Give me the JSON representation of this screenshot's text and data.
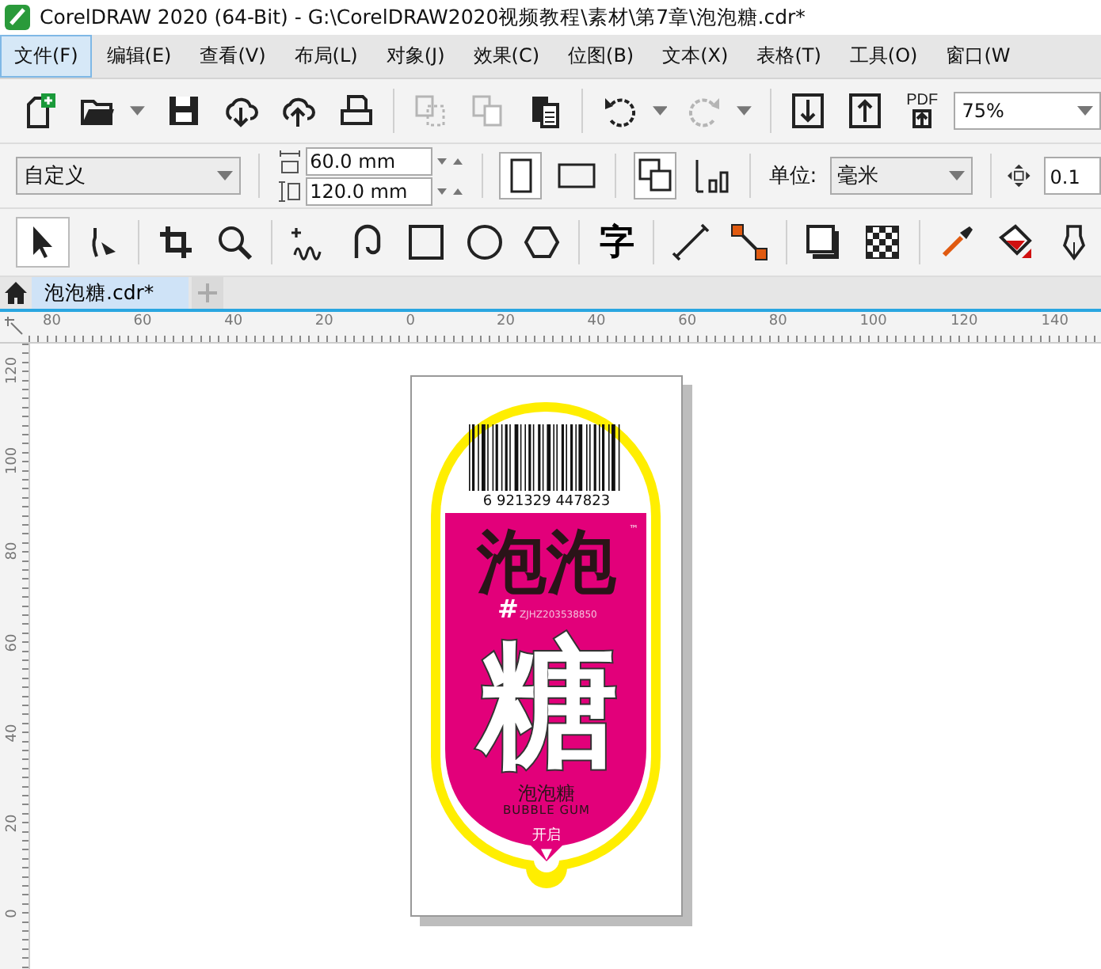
{
  "window": {
    "title": "CorelDRAW 2020 (64-Bit) - G:\\CorelDRAW2020视频教程\\素材\\第7章\\泡泡糖.cdr*"
  },
  "menu": [
    {
      "label": "文件(F)",
      "selected": true
    },
    {
      "label": "编辑(E)",
      "selected": false
    },
    {
      "label": "查看(V)",
      "selected": false
    },
    {
      "label": "布局(L)",
      "selected": false
    },
    {
      "label": "对象(J)",
      "selected": false
    },
    {
      "label": "效果(C)",
      "selected": false
    },
    {
      "label": "位图(B)",
      "selected": false
    },
    {
      "label": "文本(X)",
      "selected": false
    },
    {
      "label": "表格(T)",
      "selected": false
    },
    {
      "label": "工具(O)",
      "selected": false
    },
    {
      "label": "窗口(W",
      "selected": false
    }
  ],
  "toolbar": {
    "buttons": [
      {
        "kind": "new",
        "disabled": false
      },
      {
        "kind": "open",
        "disabled": false
      },
      {
        "kind": "save",
        "disabled": false
      },
      {
        "kind": "cloud-down",
        "disabled": false
      },
      {
        "kind": "cloud-up",
        "disabled": false
      },
      {
        "kind": "print",
        "disabled": false
      },
      {
        "kind": "cut",
        "disabled": true
      },
      {
        "kind": "copy",
        "disabled": true
      },
      {
        "kind": "paste",
        "disabled": false
      },
      {
        "kind": "undo",
        "disabled": false
      },
      {
        "kind": "redo",
        "disabled": true
      },
      {
        "kind": "import",
        "disabled": false
      },
      {
        "kind": "export",
        "disabled": false
      },
      {
        "kind": "pdf",
        "label": "PDF",
        "disabled": false
      }
    ],
    "zoom": "75%"
  },
  "property_bar": {
    "preset": "自定义",
    "width": "60.0 mm",
    "height": "120.0 mm",
    "units_label": "单位:",
    "units": "毫米",
    "nudge": "0.1"
  },
  "toolbox": [
    {
      "kind": "pick",
      "selected": true
    },
    {
      "kind": "shape",
      "selected": false
    },
    {
      "kind": "crop",
      "selected": false
    },
    {
      "kind": "zoom",
      "selected": false
    },
    {
      "kind": "freehand",
      "selected": false
    },
    {
      "kind": "artistic",
      "selected": false
    },
    {
      "kind": "rect",
      "selected": false
    },
    {
      "kind": "ellipse",
      "selected": false
    },
    {
      "kind": "polygon",
      "selected": false
    },
    {
      "kind": "text",
      "label": "字",
      "selected": false
    },
    {
      "kind": "dimension",
      "selected": false
    },
    {
      "kind": "connector",
      "selected": false
    },
    {
      "kind": "shadow",
      "selected": false
    },
    {
      "kind": "transparency",
      "selected": false
    },
    {
      "kind": "eyedropper",
      "selected": false
    },
    {
      "kind": "fill",
      "selected": false
    },
    {
      "kind": "pen",
      "selected": false
    }
  ],
  "tabs": [
    {
      "label": "泡泡糖.cdr*",
      "selected": true
    }
  ],
  "rulers": {
    "horizontal": [
      "80",
      "60",
      "40",
      "20",
      "0",
      "20",
      "40",
      "60",
      "80",
      "100",
      "120",
      "140"
    ],
    "vertical": [
      "120",
      "100",
      "80",
      "60",
      "40",
      "20",
      "0"
    ]
  },
  "artwork": {
    "barcode_number": "6 921329 447823",
    "brand": "泡泡",
    "trademark": "™",
    "hash": "#",
    "code": "ZJHZ203538850",
    "big_char": "糖",
    "name_cn": "泡泡糖",
    "name_en": "BUBBLE GUM",
    "open_label": "开启",
    "open_arrow": "▼"
  }
}
